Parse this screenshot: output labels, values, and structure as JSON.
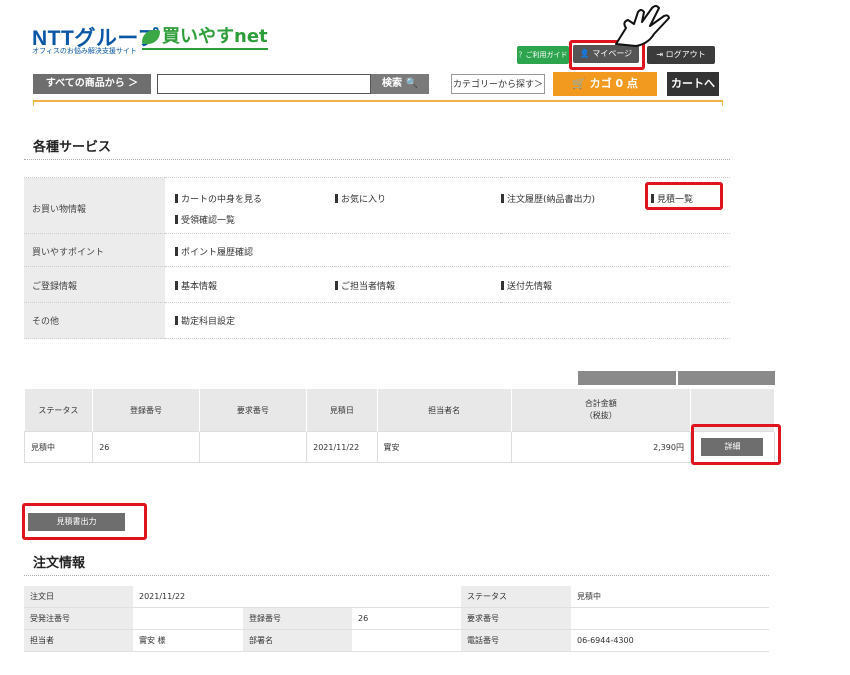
{
  "header": {
    "logo_ntt": "NTTグループ",
    "logo_sub": "オフィスのお悩み解決支援サイト",
    "logo_brand": "買いやすnet",
    "guide": "？ご利用ガイド",
    "mypage": "マイページ",
    "logout": "ログアウト",
    "all_products": "すべての商品から ＞",
    "search_value": "",
    "search_button": "検索 🔍",
    "category": "カテゴリーから探す＞",
    "cart_count": "カゴ 0 点",
    "cart_go": "カートへ"
  },
  "services": {
    "title": "各種サービス",
    "rows": [
      {
        "label": "お買い物情報",
        "items": [
          "カートの中身を見る",
          "お気に入り",
          "注文履歴(納品書出力)",
          "見積一覧",
          "受領確認一覧"
        ]
      },
      {
        "label": "買いやすポイント",
        "items": [
          "ポイント履歴確認"
        ]
      },
      {
        "label": "ご登録情報",
        "items": [
          "基本情報",
          "ご担当者情報",
          "送付先情報"
        ]
      },
      {
        "label": "その他",
        "items": [
          "勘定科目設定"
        ]
      }
    ]
  },
  "quotes": {
    "headers": [
      "ステータス",
      "登録番号",
      "要求番号",
      "見積日",
      "担当者名",
      "合計金額",
      "（税抜）"
    ],
    "rows": [
      {
        "status": "見積中",
        "reg_no": "26",
        "req_no": "",
        "date": "2021/11/22",
        "person": "實安",
        "total": "2,390円",
        "detail": "詳細"
      }
    ]
  },
  "export_button": "見積書出力",
  "order": {
    "title": "注文情報",
    "rows": [
      [
        "注文日",
        "2021/11/22",
        "",
        "",
        "ステータス",
        "見積中"
      ],
      [
        "受発注番号",
        "",
        "登録番号",
        "26",
        "要求番号",
        ""
      ],
      [
        "担当者",
        "實安 様",
        "部署名",
        "",
        "電話番号",
        "06-6944-4300"
      ]
    ]
  },
  "colors": {
    "highlight": "#e0141e",
    "brand_blue": "#0a57a6",
    "brand_green": "#2e9e3a",
    "cart_orange": "#f29a1f"
  }
}
